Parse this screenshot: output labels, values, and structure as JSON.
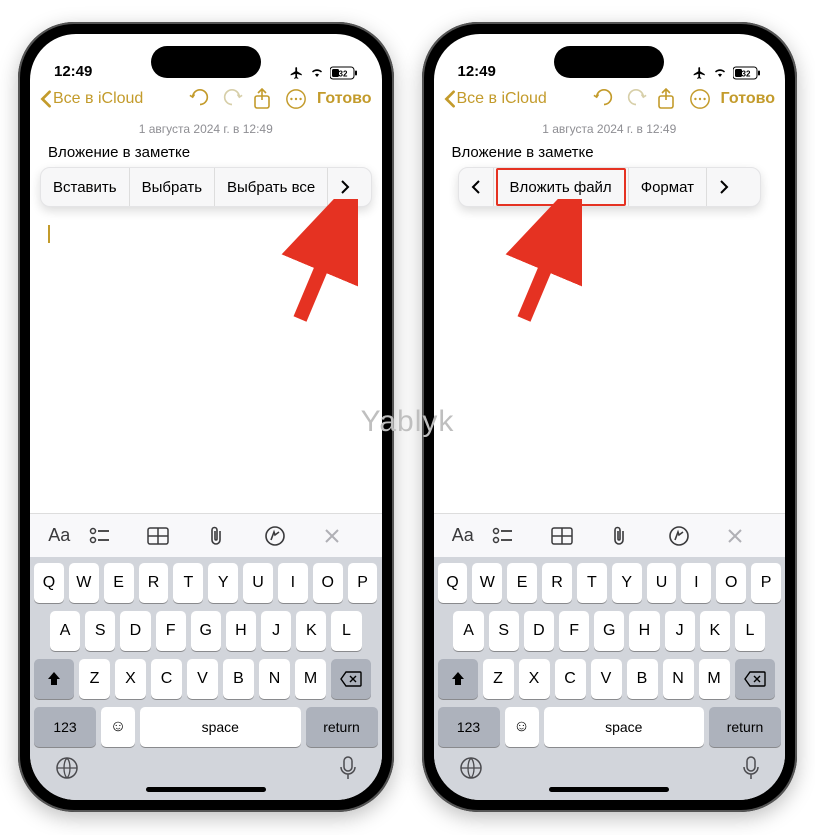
{
  "watermark": "Yablyk",
  "status": {
    "time": "12:49",
    "battery": "32"
  },
  "toolbar": {
    "back_label": "Все в iCloud",
    "done_label": "Готово"
  },
  "note": {
    "date_line": "1 августа 2024 г. в 12:49",
    "title": "Вложение в заметке"
  },
  "menu1": {
    "items": [
      "Вставить",
      "Выбрать",
      "Выбрать все"
    ]
  },
  "menu2": {
    "items": [
      "Вложить файл",
      "Формат"
    ]
  },
  "kb_toolbar": {
    "aa": "Aa"
  },
  "keyboard": {
    "row1": [
      "Q",
      "W",
      "E",
      "R",
      "T",
      "Y",
      "U",
      "I",
      "O",
      "P"
    ],
    "row2": [
      "A",
      "S",
      "D",
      "F",
      "G",
      "H",
      "J",
      "K",
      "L"
    ],
    "row3": [
      "Z",
      "X",
      "C",
      "V",
      "B",
      "N",
      "M"
    ],
    "k123": "123",
    "space": "space",
    "return": "return"
  }
}
